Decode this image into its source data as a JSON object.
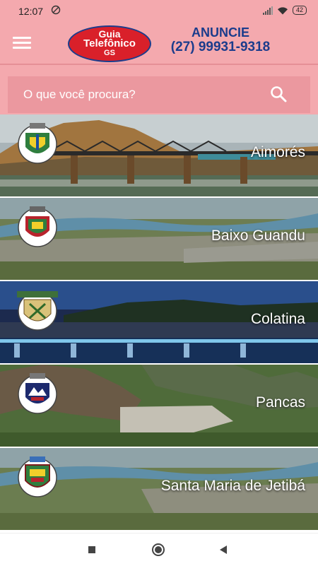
{
  "status_bar": {
    "time": "12:07",
    "battery": "42",
    "left_icon": "do-not-disturb-icon",
    "right_icons": [
      "signal-icon",
      "wifi-icon",
      "battery-icon"
    ]
  },
  "header": {
    "menu_icon": "hamburger-menu-icon",
    "logo": {
      "line1": "Guia",
      "line2": "Telefônico",
      "line3": "GS"
    },
    "ad": {
      "line1": "ANUNCIE",
      "line2": "(27) 99931-9318"
    }
  },
  "search": {
    "placeholder": "O que você procura?",
    "value": "",
    "icon": "search-icon"
  },
  "cities": [
    {
      "name": "Aimorés"
    },
    {
      "name": "Baixo Guandu"
    },
    {
      "name": "Colatina"
    },
    {
      "name": "Pancas"
    },
    {
      "name": "Santa Maria de Jetibá"
    }
  ],
  "nav_bar": {
    "icons": [
      "recents-icon",
      "home-icon",
      "back-icon"
    ]
  },
  "colors": {
    "header_bg": "#f4a9ae",
    "search_bg": "#eb989f",
    "logo_red": "#d9202a",
    "brand_blue": "#1b3c8c"
  }
}
